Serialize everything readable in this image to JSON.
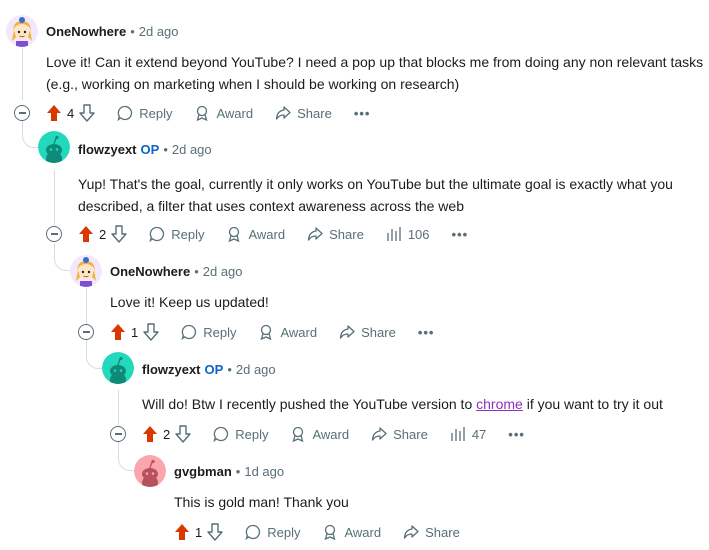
{
  "comments": [
    {
      "author": "OneNowhere",
      "op_badge": "",
      "separator": "•",
      "time": "2d ago",
      "text": "Love it! Can it extend beyond YouTube? I need a pop up that blocks me from doing any non relevant tasks (e.g., working on marketing when I should be working on research)",
      "votes": "4",
      "reply": "Reply",
      "award": "Award",
      "share": "Share",
      "views": "",
      "more": "•••"
    },
    {
      "author": "flowzyext",
      "op_badge": "OP",
      "separator": "•",
      "time": "2d ago",
      "text": "Yup! That's the goal, currently it only works on YouTube but the ultimate goal is exactly what you described, a filter that uses context awareness across the web",
      "votes": "2",
      "reply": "Reply",
      "award": "Award",
      "share": "Share",
      "views": "106",
      "more": "•••"
    },
    {
      "author": "OneNowhere",
      "op_badge": "",
      "separator": "•",
      "time": "2d ago",
      "text": "Love it! Keep us updated!",
      "votes": "1",
      "reply": "Reply",
      "award": "Award",
      "share": "Share",
      "views": "",
      "more": "•••"
    },
    {
      "author": "flowzyext",
      "op_badge": "OP",
      "separator": "•",
      "time": "2d ago",
      "text_before": "Will do! Btw I recently pushed the YouTube version to ",
      "link": "chrome",
      "text_after": " if you want to try it out",
      "votes": "2",
      "reply": "Reply",
      "award": "Award",
      "share": "Share",
      "views": "47",
      "more": "•••"
    },
    {
      "author": "gvgbman",
      "op_badge": "",
      "separator": "•",
      "time": "1d ago",
      "text": "This is gold man! Thank you",
      "votes": "1",
      "reply": "Reply",
      "award": "Award",
      "share": "Share",
      "views": "",
      "more": ""
    }
  ],
  "colors": {
    "upvote": "#d93900",
    "op": "#0a66c2",
    "link": "#8e2fbf",
    "muted": "#576f76",
    "thread_line": "#d6dde0"
  },
  "icons": [
    "avatar-onenowhere",
    "avatar-flowzyext",
    "avatar-gvgbman",
    "upvote-icon",
    "downvote-icon",
    "reply-icon",
    "award-icon",
    "share-icon",
    "views-icon",
    "more-icon",
    "collapse-icon"
  ]
}
